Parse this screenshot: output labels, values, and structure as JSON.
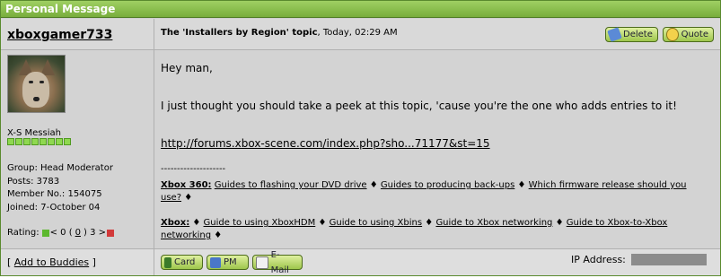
{
  "panel": {
    "title": "Personal Message"
  },
  "author": {
    "username": "xboxgamer733",
    "member_title": "X-S Messiah",
    "pips": 8,
    "group": "Group: Head Moderator",
    "posts": "Posts: 3783",
    "member_no": "Member No.: 154075",
    "joined": "Joined: 7-October 04",
    "rating_label": "Rating:",
    "rating_left": "< 0 (",
    "rating_value": "0",
    "rating_right": ") 3 >",
    "add_buddies": "Add to Buddies",
    "bracket_open": "[",
    "bracket_close": "]"
  },
  "header": {
    "topic": "The 'Installers by Region' topic",
    "date": ", Today, 02:29 AM",
    "delete_label": "Delete",
    "quote_label": "Quote"
  },
  "message": {
    "line1": "Hey man,",
    "line2": "I just thought you should take a peek at this topic, 'cause you're the one who adds entries to it!",
    "link": "http://forums.xbox-scene.com/index.php?sho...71177&st=15"
  },
  "signature": {
    "divider": "--------------------",
    "x360_label": "Xbox 360:",
    "x360_links": [
      "Guides to flashing your DVD drive",
      "Guides to producing back-ups",
      "Which firmware release should you use?"
    ],
    "xbox_label": "Xbox:",
    "xbox_links": [
      "Guide to using XboxHDM",
      "Guide to using Xbins",
      "Guide to Xbox networking",
      "Guide to Xbox-to-Xbox networking"
    ],
    "bullet": "♦"
  },
  "footer": {
    "card_label": "Card",
    "pm_label": "PM",
    "email_label": "E-Mail",
    "ip_label": "IP Address:"
  },
  "colors": {
    "accent": "#78ad3c",
    "button_border": "#4c6b1c",
    "pip": "#8fd850",
    "rating_up": "#5cb82e",
    "rating_down": "#d23a3a"
  }
}
